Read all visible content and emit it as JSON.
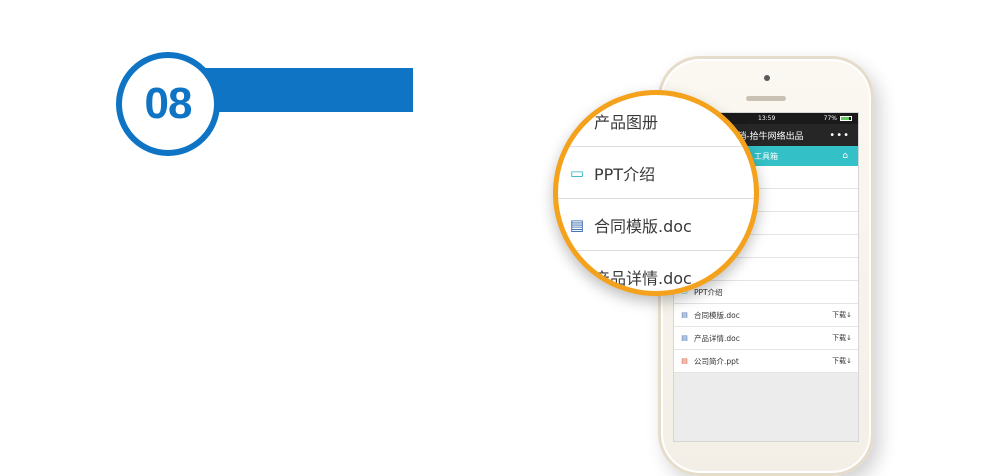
{
  "step": {
    "number": "08"
  },
  "colors": {
    "accent": "#0f74c4",
    "magnifier_ring": "#f4a11c",
    "nav": "#33c0c6"
  },
  "phone": {
    "status": {
      "time": "13:59",
      "battery": "77%"
    },
    "title": "云销-拾牛网络出品",
    "more_icon": "•••",
    "nav_title": "工具箱",
    "nav_icon": "home-icon",
    "files": [
      {
        "name": "PPT介绍",
        "icon": "folder-icon",
        "download": ""
      },
      {
        "name": "合同模版.doc",
        "icon": "doc-icon",
        "download": "下载↓"
      },
      {
        "name": "产品详情.doc",
        "icon": "doc-icon",
        "download": "下载↓"
      },
      {
        "name": "公司简介.ppt",
        "icon": "ppt-icon",
        "download": "下载↓"
      }
    ]
  },
  "magnifier": {
    "rows": [
      {
        "label": "产品图册"
      },
      {
        "label": "PPT介绍",
        "icon": "folder-icon"
      },
      {
        "label": "合同模版.doc",
        "icon": "doc-icon"
      },
      {
        "label": "产品详情.doc"
      }
    ]
  }
}
